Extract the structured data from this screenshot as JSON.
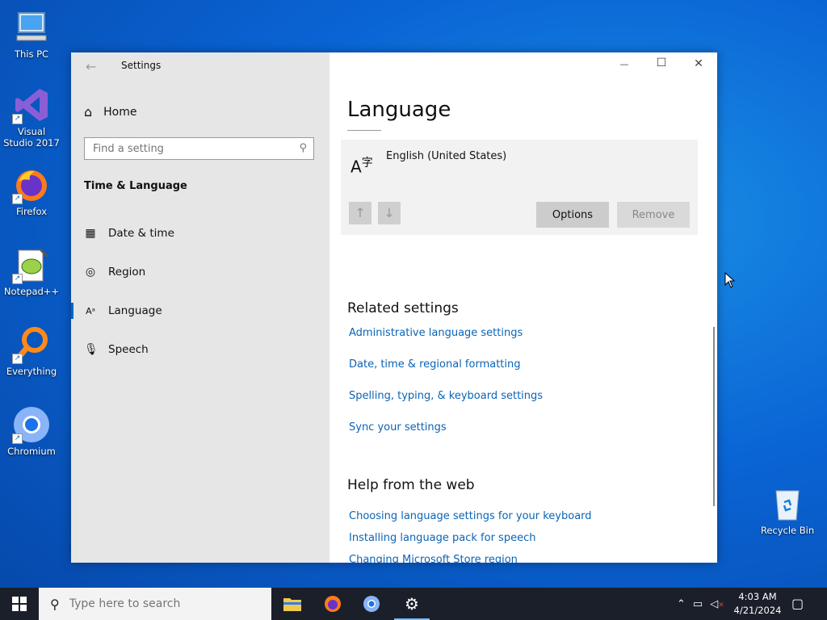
{
  "desktop": {
    "icons": [
      {
        "label": "This PC"
      },
      {
        "label": "Visual Studio 2017"
      },
      {
        "label": "Firefox"
      },
      {
        "label": "Notepad++"
      },
      {
        "label": "Everything"
      },
      {
        "label": "Chromium"
      }
    ],
    "recycle_bin": "Recycle Bin"
  },
  "window": {
    "app_title": "Settings",
    "controls": {
      "minimize": "—",
      "maximize": "☐",
      "close": "✕"
    }
  },
  "sidebar": {
    "home": "Home",
    "search_placeholder": "Find a setting",
    "section": "Time & Language",
    "items": [
      {
        "label": "Date & time",
        "icon": "calendar-clock-icon"
      },
      {
        "label": "Region",
        "icon": "globe-icon"
      },
      {
        "label": "Language",
        "icon": "language-icon",
        "active": true
      },
      {
        "label": "Speech",
        "icon": "microphone-icon"
      }
    ]
  },
  "main": {
    "title": "Language",
    "language_entry": {
      "name": "English (United States)"
    },
    "buttons": {
      "options": "Options",
      "remove": "Remove",
      "move_up": "↑",
      "move_down": "↓"
    },
    "related": {
      "title": "Related settings",
      "links": [
        "Administrative language settings",
        "Date, time & regional formatting",
        "Spelling, typing, & keyboard settings",
        "Sync your settings"
      ]
    },
    "help": {
      "title": "Help from the web",
      "links": [
        "Choosing language settings for your keyboard",
        "Installing language pack for speech",
        "Changing Microsoft Store region"
      ]
    }
  },
  "taskbar": {
    "search_placeholder": "Type here to search",
    "apps": [
      "file-explorer",
      "firefox",
      "chromium",
      "settings"
    ],
    "time": "4:03 AM",
    "date": "4/21/2024"
  },
  "colors": {
    "accent": "#0067c0",
    "link": "#0b63b6",
    "taskbar": "#1b1f2a"
  }
}
